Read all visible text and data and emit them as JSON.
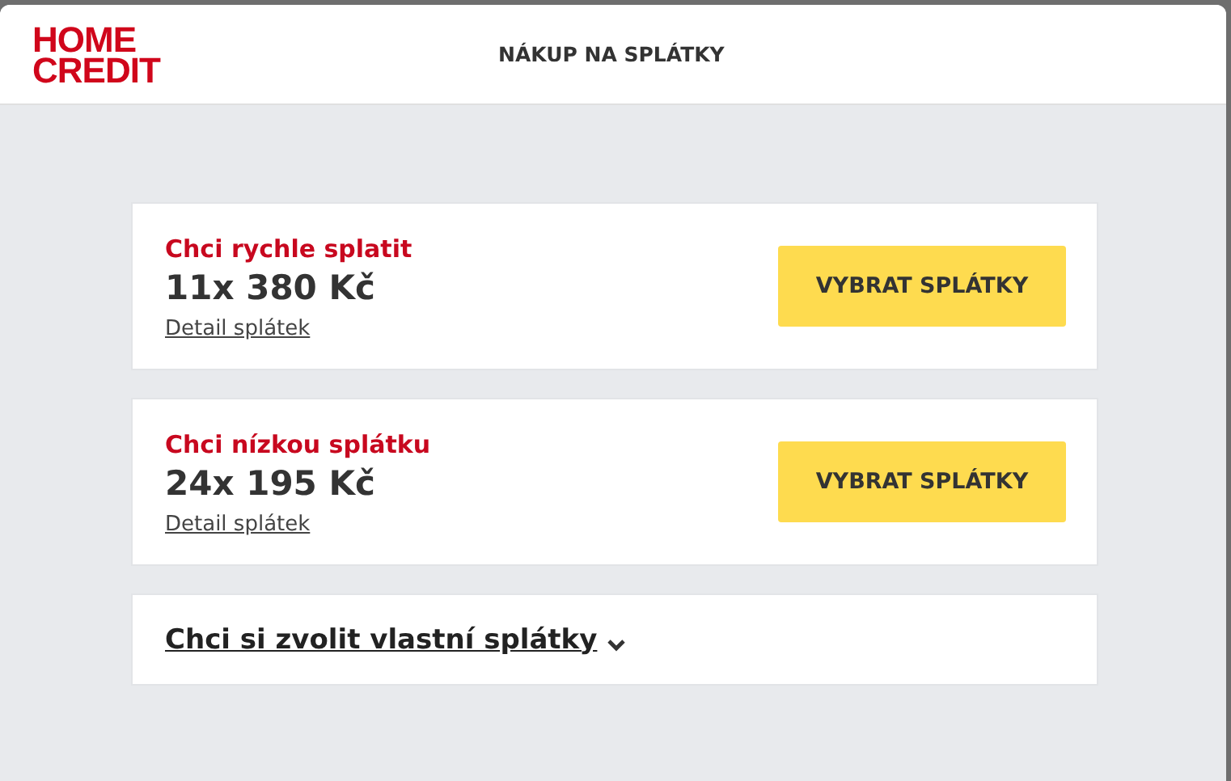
{
  "header": {
    "logo_lines": [
      "HOME",
      "CREDIT"
    ],
    "title": "NÁKUP NA SPLÁTKY"
  },
  "offers": [
    {
      "heading": "Chci rychle splatit",
      "amount": "11x 380 Kč",
      "detail_link": "Detail splátek",
      "button": "VYBRAT SPLÁTKY"
    },
    {
      "heading": "Chci nízkou splátku",
      "amount": "24x 195 Kč",
      "detail_link": "Detail splátek",
      "button": "VYBRAT SPLÁTKY"
    }
  ],
  "custom": {
    "label": "Chci si zvolit vlastní splátky",
    "expanded": false
  }
}
